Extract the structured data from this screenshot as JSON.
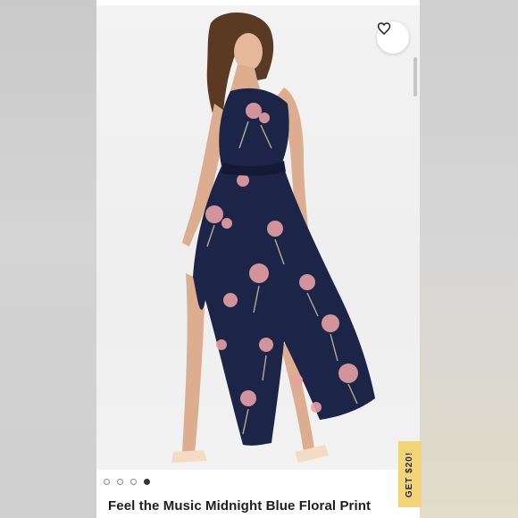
{
  "product": {
    "title": "Feel the Music Midnight Blue Floral Print"
  },
  "gallery": {
    "image_count": 4,
    "active_index": 3
  },
  "favorite": {
    "icon": "heart-outline-icon"
  },
  "promo": {
    "label": "GET $20!"
  },
  "colors": {
    "promo_bg": "#f3d479",
    "dress_navy": "#1c2447",
    "flower_pink": "#e6a1a4"
  }
}
